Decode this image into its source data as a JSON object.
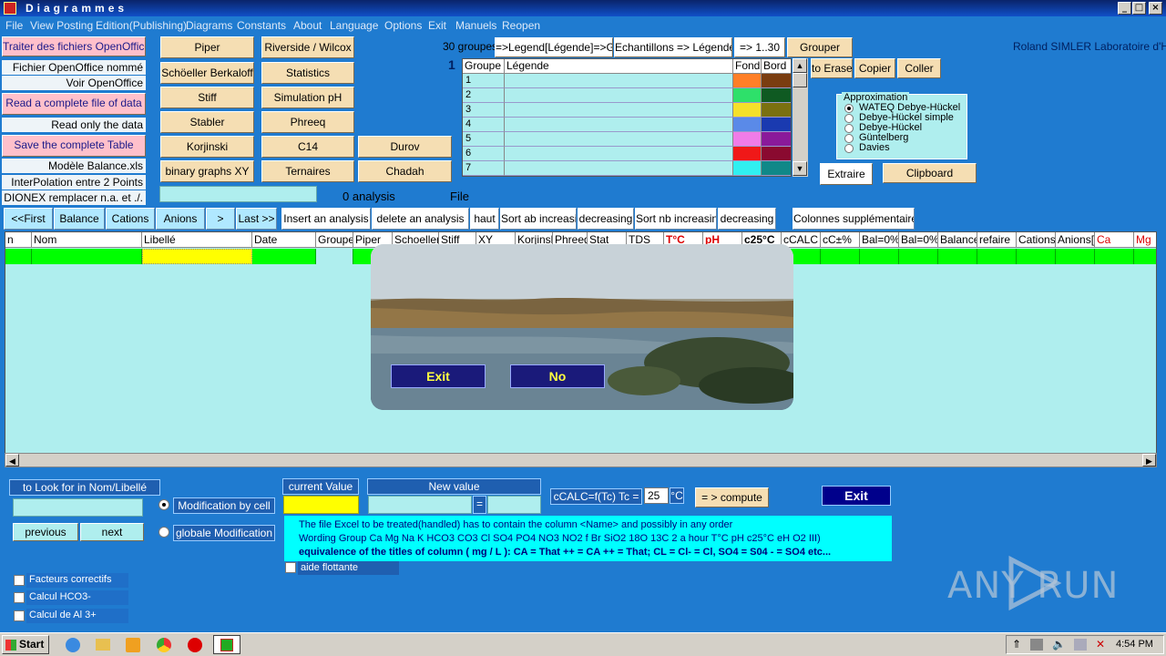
{
  "window": {
    "title": "Diagrammes",
    "controls": [
      "_",
      "□",
      "×"
    ]
  },
  "menu": [
    "File",
    "View Posting",
    "Edition(Publishing)",
    "Diagrams",
    "Constants",
    "About",
    "Language",
    "Options",
    "Exit",
    "Manuels",
    "Reopen"
  ],
  "left_panel": {
    "traiter": "Traiter des fichiers OpenOffice",
    "fichier_nomme": "Fichier OpenOffice nommé",
    "voir": "Voir OpenOffice",
    "read_complete": "Read a complete file of data",
    "read_only": "Read only the data",
    "save_table": "Save the complete Table",
    "modele": "Modèle Balance.xls",
    "interpolation": "InterPolation entre 2 Points",
    "dionex": "DIONEX remplacer n.a. et ./."
  },
  "diagram_buttons": [
    "Piper",
    "Riverside / Wilcox",
    "Schöeller Berkaloff",
    "Statistics",
    "Stiff",
    "Simulation pH",
    "Stabler",
    "Phreeq",
    "Korjinski",
    "C14",
    "Durov",
    "binary graphs XY",
    "Ternaires",
    "Chadah"
  ],
  "status": {
    "analysis": "0 analysis",
    "file": "File"
  },
  "legend_toolbar": {
    "groups_count": "30 groupes",
    "legend_to_group": "=>Legend[Légende]=>Gro",
    "echantillons": "Echantillons => Légende",
    "range": "=> 1..30",
    "grouper": "Grouper",
    "to_erase": "to Erase",
    "copier": "Copier",
    "coller": "Coller",
    "credit": "Roland SIMLER Laboratoire d'Hydr",
    "current_num": "1"
  },
  "legend_table": {
    "headers": [
      "Groupe",
      "Légende",
      "Fond",
      "Bord"
    ],
    "rows": [
      {
        "n": "1",
        "fond": "#ff7f27",
        "bord": "#7a3d10"
      },
      {
        "n": "2",
        "fond": "#2ee06a",
        "bord": "#0f5a22"
      },
      {
        "n": "3",
        "fond": "#f5e02a",
        "bord": "#7a7010"
      },
      {
        "n": "4",
        "fond": "#5a8ae8",
        "bord": "#1a3ab0"
      },
      {
        "n": "5",
        "fond": "#f07ce8",
        "bord": "#8a1a9a"
      },
      {
        "n": "6",
        "fond": "#f01818",
        "bord": "#8a0a30"
      },
      {
        "n": "7",
        "fond": "#30f0f0",
        "bord": "#108888"
      }
    ]
  },
  "approximation": {
    "title": "Approximation",
    "options": [
      "WATEQ Debye-Hückel",
      "Debye-Hückel simple",
      "Debye-Hückel",
      "Güntelberg",
      "Davies"
    ],
    "selected": 0
  },
  "extraire": "Extraire",
  "clipboard": "Clipboard",
  "nav_buttons": [
    "<<First",
    "Balance",
    "Cations",
    "Anions",
    ">",
    "Last >>",
    "Insert an analysis",
    "delete an analysis",
    "haut",
    "Sort ab increasing",
    "decreasing",
    "Sort nb increasing",
    "decreasing",
    "Colonnes supplémentaires"
  ],
  "grid_headers": [
    "n",
    "Nom",
    "Libellé",
    "Date",
    "Groupe",
    "Piper",
    "Schoeller",
    "Stiff",
    "XY",
    "Korjinski",
    "Phreeg",
    "Stat",
    "TDS",
    "T°C",
    "pH",
    "c25°C",
    "cCALC",
    "cC±%",
    "Bal=0%",
    "Bal=0%",
    "Balance",
    "refaire",
    "Cations[",
    "Anions[m",
    "Ca",
    "Mg"
  ],
  "splash": {
    "exit": "Exit",
    "no": "No"
  },
  "bottom": {
    "look_for": "to Look for in Nom/Libellé",
    "previous": "previous",
    "next": "next",
    "modif_cell": "Modification by cell",
    "globale": "globale Modification",
    "current_value": "current Value",
    "new_value": "New value",
    "equals": "=",
    "ccalc": "cCALC=f(Tc) Tc =",
    "tc_value": "25",
    "unit": "°C",
    "compute": "= > compute",
    "exit": "Exit",
    "info1": "The file Excel to be treated(handled) has to contain the column <Name> and possibly in any order",
    "info2": "Wording Group Ca Mg Na K HCO3 CO3 Cl SO4 PO4 NO3 NO2 f Br SiO2 18O 13C 2 a hour T°C pH c25°C eH O2 III)",
    "info3": "equivalence of the titles of column ( mg / L ): CA = That ++ = CA ++ = That; CL = Cl- = Cl, SO4 = S04 - = SO4 etc...",
    "aide": "aide flottante",
    "facteurs": "Facteurs correctifs",
    "calcul_hco3": "Calcul HCO3-",
    "calcul_al": "Calcul de Al 3+"
  },
  "watermark": "ANY RUN",
  "taskbar": {
    "start": "Start",
    "time": "4:54 PM"
  }
}
